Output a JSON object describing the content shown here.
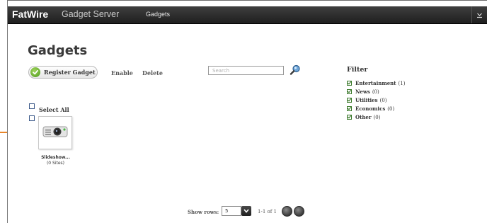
{
  "header": {
    "brand": "FatWire",
    "product": "Gadget Server",
    "nav_item": "Gadgets",
    "menu_toggle_icon": "chevron-down-icon"
  },
  "page": {
    "title": "Gadgets"
  },
  "toolbar": {
    "register_label": "Register Gadget",
    "enable_label": "Enable",
    "delete_label": "Delete",
    "search_placeholder": "Search",
    "search_value": ""
  },
  "filter": {
    "heading": "Filter",
    "items": [
      {
        "name": "Entertainment",
        "count": "(1)",
        "checked": true
      },
      {
        "name": "News",
        "count": "(0)",
        "checked": true
      },
      {
        "name": "Utilities",
        "count": "(0)",
        "checked": true
      },
      {
        "name": "Economics",
        "count": "(0)",
        "checked": true
      },
      {
        "name": "Other",
        "count": "(0)",
        "checked": true
      }
    ]
  },
  "list": {
    "select_all_label": "Select All",
    "gadgets": [
      {
        "name": "Slideshow...",
        "sites": "(0 Sites)",
        "icon": "projector-icon"
      }
    ]
  },
  "pagination": {
    "show_rows_label": "Show rows:",
    "rows_value": "5",
    "range": "1-1 of 1"
  },
  "colors": {
    "topbar": "#2b2b2b",
    "accent_green": "#4e9a1e",
    "callout_orange": "#e8862a"
  }
}
